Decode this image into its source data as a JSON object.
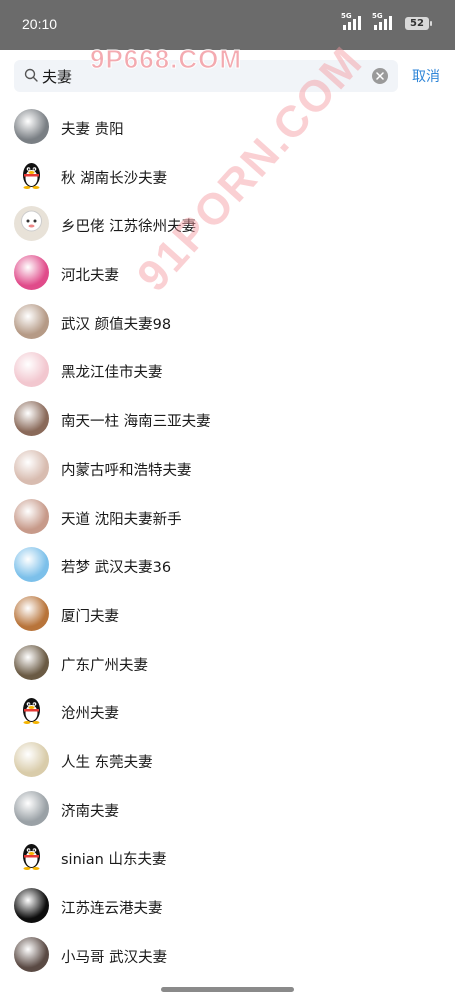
{
  "status_bar": {
    "time": "20:10",
    "signal_1_label": "5G",
    "signal_2_label": "5G",
    "battery": "52"
  },
  "search": {
    "value": "夫妻",
    "cancel_label": "取消"
  },
  "watermarks": {
    "top": "9P668.COM",
    "diagonal": "91PORN.COM"
  },
  "results": [
    {
      "name": "夫妻  贵阳",
      "avatar": "photo",
      "color": "#7a7f84"
    },
    {
      "name": "秋 湖南长沙夫妻",
      "avatar": "qq-penguin",
      "color": "#111111"
    },
    {
      "name": "乡巴佬 江苏徐州夫妻",
      "avatar": "sheep-cartoon",
      "color": "#e8e2d8"
    },
    {
      "name": "河北夫妻",
      "avatar": "photo",
      "color": "#e04b8a"
    },
    {
      "name": "武汉 颜值夫妻98",
      "avatar": "photo",
      "color": "#b59a86"
    },
    {
      "name": "黑龙江佳市夫妻",
      "avatar": "photo",
      "color": "#f2c7cf"
    },
    {
      "name": "南天一柱 海南三亚夫妻",
      "avatar": "photo",
      "color": "#8a6a5a"
    },
    {
      "name": "内蒙古呼和浩特夫妻",
      "avatar": "photo",
      "color": "#d8bcb0"
    },
    {
      "name": "天道 沈阳夫妻新手",
      "avatar": "photo",
      "color": "#c79a8a"
    },
    {
      "name": "若梦 武汉夫妻36",
      "avatar": "photo",
      "color": "#7cc0ea"
    },
    {
      "name": "厦门夫妻",
      "avatar": "photo",
      "color": "#b8743a"
    },
    {
      "name": "广东广州夫妻",
      "avatar": "photo",
      "color": "#6a5a44"
    },
    {
      "name": "沧州夫妻",
      "avatar": "qq-penguin",
      "color": "#111111"
    },
    {
      "name": "人生 东莞夫妻",
      "avatar": "photo",
      "color": "#d9ccaa"
    },
    {
      "name": "济南夫妻",
      "avatar": "photo",
      "color": "#9aa1a6"
    },
    {
      "name": "sinian  山东夫妻",
      "avatar": "qq-penguin",
      "color": "#111111"
    },
    {
      "name": "江苏连云港夫妻",
      "avatar": "photo",
      "color": "#0d0d0d"
    },
    {
      "name": "小马哥 武汉夫妻",
      "avatar": "photo",
      "color": "#5a4a44"
    }
  ]
}
